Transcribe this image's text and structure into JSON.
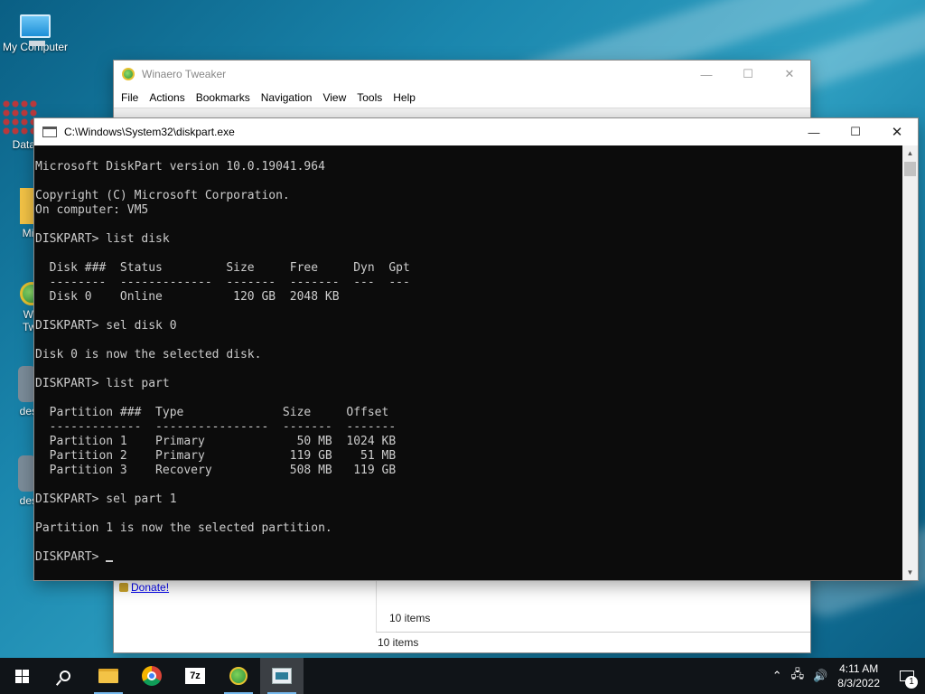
{
  "desktop": {
    "icons": [
      {
        "label": "My Computer"
      },
      {
        "label": "DataW"
      },
      {
        "label": "Micr"
      },
      {
        "label": "Win\nTwe"
      },
      {
        "label": "deskt"
      },
      {
        "label": "deskt"
      }
    ]
  },
  "winaero": {
    "title": "Winaero Tweaker",
    "menu": [
      "File",
      "Actions",
      "Bookmarks",
      "Navigation",
      "View",
      "Tools",
      "Help"
    ],
    "donate_label": "Donate!",
    "items_count_1": "10 items",
    "items_count_2": "10 items"
  },
  "console": {
    "title": "C:\\Windows\\System32\\diskpart.exe",
    "lines": [
      "Microsoft DiskPart version 10.0.19041.964",
      "",
      "Copyright (C) Microsoft Corporation.",
      "On computer: VM5",
      "",
      "DISKPART> list disk",
      "",
      "  Disk ###  Status         Size     Free     Dyn  Gpt",
      "  --------  -------------  -------  -------  ---  ---",
      "  Disk 0    Online          120 GB  2048 KB",
      "",
      "DISKPART> sel disk 0",
      "",
      "Disk 0 is now the selected disk.",
      "",
      "DISKPART> list part",
      "",
      "  Partition ###  Type              Size     Offset",
      "  -------------  ----------------  -------  -------",
      "  Partition 1    Primary             50 MB  1024 KB",
      "  Partition 2    Primary            119 GB    51 MB",
      "  Partition 3    Recovery           508 MB   119 GB",
      "",
      "DISKPART> sel part 1",
      "",
      "Partition 1 is now the selected partition.",
      ""
    ],
    "prompt": "DISKPART> "
  },
  "window_buttons": {
    "minimize": "—",
    "maximize": "☐",
    "close": "✕"
  },
  "taskbar": {
    "apps": [
      {
        "icon": "start-icon"
      },
      {
        "icon": "search-icon"
      },
      {
        "icon": "file-explorer-icon"
      },
      {
        "icon": "chrome-icon"
      },
      {
        "icon": "7zip-icon",
        "label": "7z"
      },
      {
        "icon": "winaero-tweaker-icon"
      },
      {
        "icon": "console-icon"
      }
    ],
    "tray": {
      "chevron": "⌃",
      "network": "🖧",
      "volume": "🔊",
      "time": "4:11 AM",
      "date": "8/3/2022",
      "notification_count": "1"
    }
  }
}
